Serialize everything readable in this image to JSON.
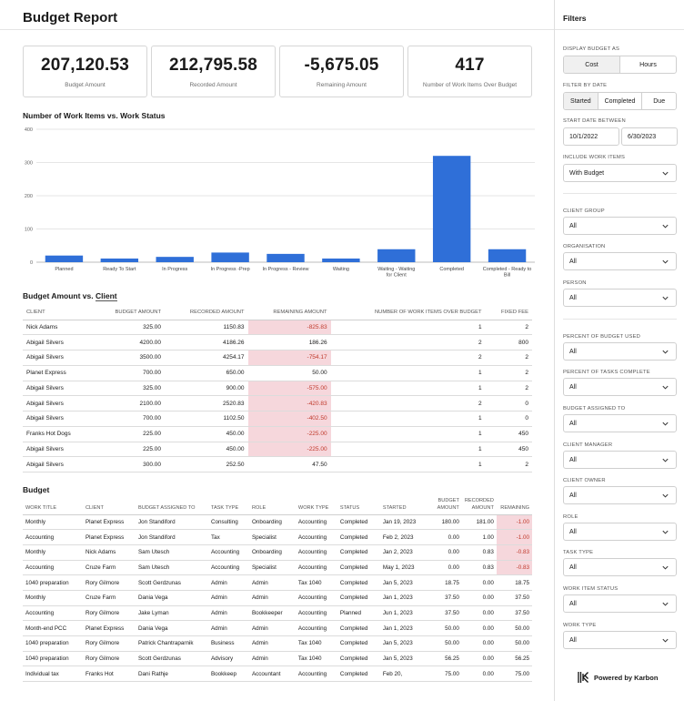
{
  "report": {
    "title": "Budget Report"
  },
  "kpis": [
    {
      "value": "207,120.53",
      "label": "Budget Amount"
    },
    {
      "value": "212,795.58",
      "label": "Recorded Amount"
    },
    {
      "value": "-5,675.05",
      "label": "Remaining Amount"
    },
    {
      "value": "417",
      "label": "Number of Work Items Over Budget"
    }
  ],
  "chart_section": {
    "title": "Number of Work Items vs. Work Status"
  },
  "chart_data": {
    "type": "bar",
    "title": "Number of Work Items vs. Work Status",
    "xlabel": "",
    "ylabel": "",
    "ylim": [
      0,
      400
    ],
    "yticks": [
      "0",
      "100",
      "200",
      "300",
      "400"
    ],
    "categories": [
      "Planned",
      "Ready To Start",
      "In Progress",
      "In Progress -Prep",
      "In Progress - Review",
      "Waiting",
      "Waiting - Waiting for Client",
      "Completed",
      "Completed - Ready to Bill"
    ],
    "values": [
      20,
      11,
      16,
      29,
      25,
      11,
      39,
      320,
      39
    ],
    "grid": true,
    "color": "#2f6fd8"
  },
  "client_table": {
    "title_prefix": "Budget Amount vs.",
    "title_client": "Client",
    "headers": [
      "CLIENT",
      "BUDGET AMOUNT",
      "RECORDED AMOUNT",
      "REMAINING AMOUNT",
      "NUMBER OF WORK ITEMS OVER BUDGET",
      "FIXED FEE"
    ],
    "rows": [
      [
        "Nick Adams",
        "325.00",
        "1150.83",
        "-825.83",
        "1",
        "2"
      ],
      [
        "Abigail Silvers",
        "4200.00",
        "4186.26",
        "186.26",
        "2",
        "800"
      ],
      [
        "Abigail Silvers",
        "3500.00",
        "4254.17",
        "-754.17",
        "2",
        "2"
      ],
      [
        "Planet Express",
        "700.00",
        "650.00",
        "50.00",
        "1",
        "2"
      ],
      [
        "Abigail Silvers",
        "325.00",
        "900.00",
        "-575.00",
        "1",
        "2"
      ],
      [
        "Abigail Silvers",
        "2100.00",
        "2520.83",
        "-420.83",
        "2",
        "0"
      ],
      [
        "Abigail Silvers",
        "700.00",
        "1102.50",
        "-402.50",
        "1",
        "0"
      ],
      [
        "Franks Hot Dogs",
        "225.00",
        "450.00",
        "-225.00",
        "1",
        "450"
      ],
      [
        "Abigail Silvers",
        "225.00",
        "450.00",
        "-225.00",
        "1",
        "450"
      ],
      [
        "Abigail Silvers",
        "300.00",
        "252.50",
        "47.50",
        "1",
        "2"
      ]
    ]
  },
  "budget_table": {
    "title": "Budget",
    "headers": [
      "WORK TITLE",
      "CLIENT",
      "BUDGET ASSIGNED TO",
      "TASK TYPE",
      "ROLE",
      "WORK TYPE",
      "STATUS",
      "STARTED",
      "BUDGET AMOUNT",
      "RECORDED AMOUNT",
      "REMAINING"
    ],
    "rows": [
      [
        "Monthly",
        "Planet Express",
        "Jon Standiford",
        "Consulting",
        "Onboarding",
        "Accounting",
        "Completed",
        "Jan 19, 2023",
        "180.00",
        "181.00",
        "-1.00"
      ],
      [
        "Accounting",
        "Planet Express",
        "Jon Standiford",
        "Tax",
        "Specialist",
        "Accounting",
        "Completed",
        "Feb 2, 2023",
        "0.00",
        "1.00",
        "-1.00"
      ],
      [
        "Monthly",
        "Nick Adams",
        "Sam Utesch",
        "Accounting",
        "Onboarding",
        "Accounting",
        "Completed",
        "Jan 2, 2023",
        "0.00",
        "0.83",
        "-0.83"
      ],
      [
        "Accounting",
        "Cruze Farm",
        "Sam Utesch",
        "Accounting",
        "Specialist",
        "Accounting",
        "Completed",
        "May 1, 2023",
        "0.00",
        "0.83",
        "-0.83"
      ],
      [
        "1040 preparation",
        "Rory Gilmore",
        "Scott Gerdzunas",
        "Admin",
        "Admin",
        "Tax 1040",
        "Completed",
        "Jan 5, 2023",
        "18.75",
        "0.00",
        "18.75"
      ],
      [
        "Monthly",
        "Cruze Farm",
        "Dania Vega",
        "Admin",
        "Admin",
        "Accounting",
        "Completed",
        "Jan 1, 2023",
        "37.50",
        "0.00",
        "37.50"
      ],
      [
        "Accounting",
        "Rory Gilmore",
        "Jake Lyman",
        "Admin",
        "Bookkeeper",
        "Accounting",
        "Planned",
        "Jun 1, 2023",
        "37.50",
        "0.00",
        "37.50"
      ],
      [
        "Month-end PCC",
        "Planet Express",
        "Dania Vega",
        "Admin",
        "Admin",
        "Accounting",
        "Completed",
        "Jan 1, 2023",
        "50.00",
        "0.00",
        "50.00"
      ],
      [
        "1040 preparation",
        "Rory Gilmore",
        "Patrick Chantraparnik",
        "Business",
        "Admin",
        "Tax 1040",
        "Completed",
        "Jan 5, 2023",
        "50.00",
        "0.00",
        "50.00"
      ],
      [
        "1040 preparation",
        "Rory Gilmore",
        "Scott Gerdzunas",
        "Advisory",
        "Admin",
        "Tax 1040",
        "Completed",
        "Jan 5, 2023",
        "56.25",
        "0.00",
        "56.25"
      ],
      [
        "Individual tax",
        "Franks Hot",
        "Dani Rathje",
        "Bookkeep",
        "Accountant",
        "Accounting",
        "Completed",
        "Feb 20,",
        "75.00",
        "0.00",
        "75.00"
      ]
    ]
  },
  "filters": {
    "title": "Filters",
    "display_budget_as": {
      "label": "DISPLAY BUDGET AS",
      "options": [
        "Cost",
        "Hours"
      ],
      "selected": "Cost"
    },
    "filter_by_date": {
      "label": "FILTER BY DATE",
      "options": [
        "Started",
        "Completed",
        "Due"
      ],
      "selected": "Started"
    },
    "start_date_between": {
      "label": "START DATE BETWEEN",
      "from": "10/1/2022",
      "to": "6/30/2023"
    },
    "include_work_items": {
      "label": "INCLUDE WORK ITEMS",
      "value": "With Budget"
    },
    "dropdowns": [
      {
        "label": "CLIENT GROUP",
        "value": "All"
      },
      {
        "label": "ORGANISATION",
        "value": "All"
      },
      {
        "label": "PERSON",
        "value": "All"
      },
      {
        "label": "PERCENT OF BUDGET USED",
        "value": "All"
      },
      {
        "label": "PERCENT OF TASKS COMPLETE",
        "value": "All"
      },
      {
        "label": "BUDGET ASSIGNED TO",
        "value": "All"
      },
      {
        "label": "CLIENT MANAGER",
        "value": "All"
      },
      {
        "label": "CLIENT OWNER",
        "value": "All"
      },
      {
        "label": "ROLE",
        "value": "All"
      },
      {
        "label": "TASK TYPE",
        "value": "All"
      },
      {
        "label": "WORK ITEM STATUS",
        "value": "All"
      },
      {
        "label": "WORK TYPE",
        "value": "All"
      }
    ]
  },
  "brand": {
    "text": "Powered by Karbon",
    "icon": "karbon-logo-icon"
  }
}
